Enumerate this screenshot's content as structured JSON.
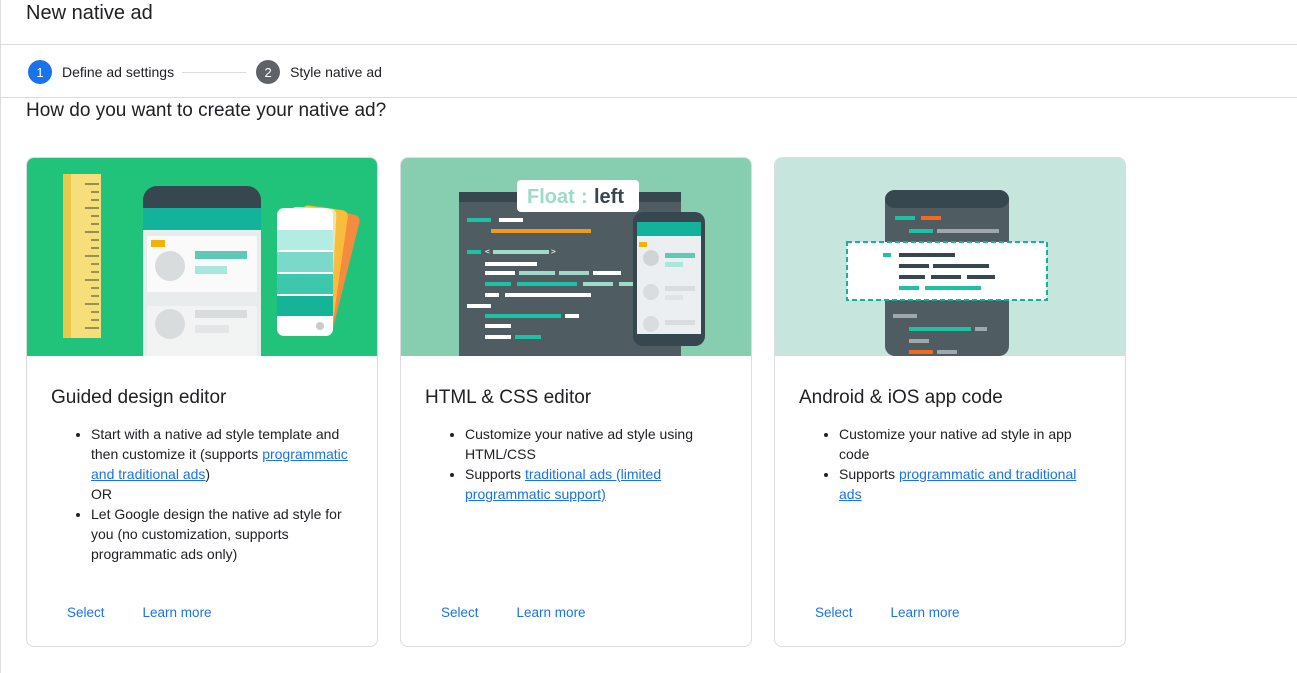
{
  "page": {
    "title": "New native ad"
  },
  "stepper": {
    "steps": [
      {
        "number": "1",
        "label": "Define ad settings"
      },
      {
        "number": "2",
        "label": "Style native ad"
      }
    ]
  },
  "main": {
    "question": "How do you want to create your native ad?"
  },
  "cards": [
    {
      "title": "Guided design editor",
      "bullet1_text": "Start with a native ad style template and then customize it (supports ",
      "bullet1_link": "programmatic and traditional ads",
      "bullet1_suffix": ")",
      "or_text": "OR",
      "bullet2_text": "Let Google design the native ad style for you (no customization, supports programmatic ads only)",
      "select_label": "Select",
      "learn_more_label": "Learn more",
      "art_bg": "#21c37a"
    },
    {
      "title": "HTML & CSS editor",
      "bullet1_text": "Customize your native ad style using HTML/CSS",
      "bullet2_text": "Supports ",
      "bullet2_link": "traditional ads (limited programmatic support)",
      "select_label": "Select",
      "learn_more_label": "Learn more",
      "art_label_a": "Float",
      "art_label_b": ":",
      "art_label_c": "left",
      "art_bg": "#87cdb0"
    },
    {
      "title": "Android & iOS app code",
      "bullet1_text": "Customize your native ad style in app code",
      "bullet2_text": "Supports ",
      "bullet2_link": "programmatic and traditional ads",
      "select_label": "Select",
      "learn_more_label": "Learn more",
      "art_bg": "#c6e6dd"
    }
  ],
  "colors": {
    "accent": "#1a73e8",
    "step_inactive": "#5f6368",
    "border": "#dadce0"
  }
}
